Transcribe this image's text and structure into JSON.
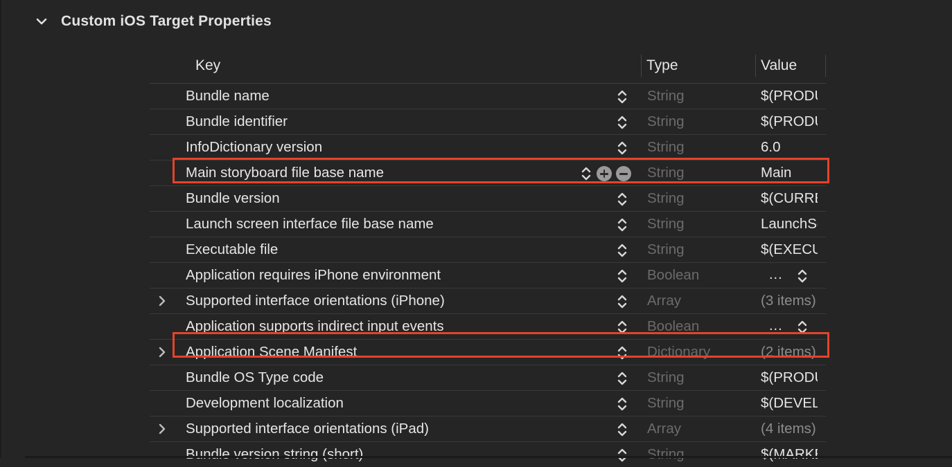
{
  "section": {
    "title": "Custom iOS Target Properties",
    "icon": "chevron-down-icon"
  },
  "columns": {
    "key": "Key",
    "type": "Type",
    "value": "Value"
  },
  "rows": [
    {
      "key": "Bundle name",
      "type": "String",
      "value": "$(PRODUCT_NAME)",
      "expandable": false
    },
    {
      "key": "Bundle identifier",
      "type": "String",
      "value": "$(PRODUCT_BUNDLE_IDENTIFIER)",
      "expandable": false
    },
    {
      "key": "InfoDictionary version",
      "type": "String",
      "value": "6.0",
      "expandable": false
    },
    {
      "key": "Main storyboard file base name",
      "type": "String",
      "value": "Main",
      "expandable": false,
      "selected": true
    },
    {
      "key": "Bundle version",
      "type": "String",
      "value": "$(CURRENT_PROJECT_VERSION)",
      "expandable": false
    },
    {
      "key": "Launch screen interface file base name",
      "type": "String",
      "value": "LaunchScreen",
      "expandable": false
    },
    {
      "key": "Executable file",
      "type": "String",
      "value": "$(EXECUTABLE_NAME)",
      "expandable": false
    },
    {
      "key": "Application requires iPhone environment",
      "type": "Boolean",
      "value": "...",
      "expandable": false,
      "popup": true
    },
    {
      "key": "Supported interface orientations (iPhone)",
      "type": "Array",
      "value": "(3 items)",
      "expandable": true
    },
    {
      "key": "Application supports indirect input events",
      "type": "Boolean",
      "value": "...",
      "expandable": false,
      "popup": true
    },
    {
      "key": "Application Scene Manifest",
      "type": "Dictionary",
      "value": "(2 items)",
      "expandable": true
    },
    {
      "key": "Bundle OS Type code",
      "type": "String",
      "value": "$(PRODUCT_BUNDLE_PACKAGE_TYPE)",
      "expandable": false
    },
    {
      "key": "Development localization",
      "type": "String",
      "value": "$(DEVELOPMENT_LANGUAGE)",
      "expandable": false
    },
    {
      "key": "Supported interface orientations (iPad)",
      "type": "Array",
      "value": "(4 items)",
      "expandable": true
    },
    {
      "key": "Bundle version string (short)",
      "type": "String",
      "value": "$(MARKETING_VERSION)",
      "expandable": false
    }
  ],
  "highlight_color": "#e5432a"
}
